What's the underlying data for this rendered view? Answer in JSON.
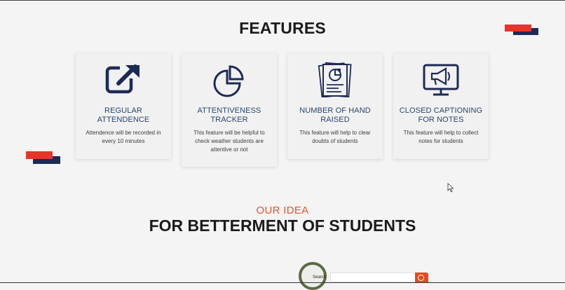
{
  "features": {
    "heading": "FEATURES",
    "cards": [
      {
        "title": "REGULAR ATTENDENCE",
        "description": "Attendence will be recorded in every 10 minutes",
        "icon": "external-link-icon"
      },
      {
        "title": "ATTENTIVENESS TRACKER",
        "description": "This feature will be helpful to check weather students are attentive or not",
        "icon": "pie-chart-icon"
      },
      {
        "title": "NUMBER OF HAND RAISED",
        "description": "This feature will help to clear doubts of students",
        "icon": "report-document-icon"
      },
      {
        "title": "CLOSED CAPTIONING FOR NOTES",
        "description": "This feature will help to collect notes for students",
        "icon": "megaphone-monitor-icon"
      }
    ]
  },
  "idea": {
    "kicker": "OUR IDEA",
    "title": "FOR BETTERMENT OF STUDENTS"
  },
  "search_preview": {
    "label": "Search"
  },
  "colors": {
    "accent_red": "#e8342a",
    "navy": "#1d2a56",
    "card_title": "#28456b",
    "kicker": "#e2542f"
  }
}
